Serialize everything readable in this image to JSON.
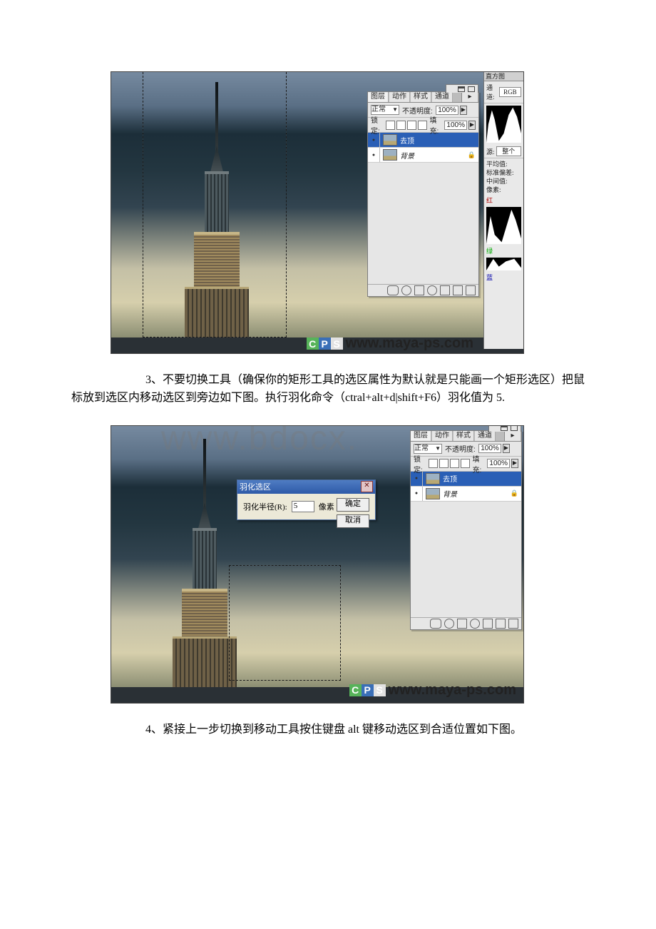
{
  "paragraph3": "3、不要切换工具（确保你的矩形工具的选区属性为默认就是只能画一个矩形选区）把鼠标放到选区内移动选区到旁边如下图。执行羽化命令（ctral+alt+d|shift+F6）羽化值为 5.",
  "paragraph4": "4、紧接上一步切换到移动工具按住键盘 alt 键移动选区到合适位置如下图。",
  "layers_panel": {
    "tabs": [
      "图层",
      "动作",
      "样式",
      "通道"
    ],
    "menu_glyph": "▸",
    "blend_mode": "正常",
    "opacity_label": "不透明度:",
    "opacity_value": "100%",
    "lock_label": "锁定:",
    "fill_label": "填充:",
    "fill_value": "100%",
    "items": [
      {
        "name": "去顶",
        "active": true,
        "has_lock": false
      },
      {
        "name": "背景",
        "active": false,
        "has_lock": true
      }
    ],
    "lock_glyph": "🔒"
  },
  "histogram": {
    "panel_title": "直方图",
    "channel_label": "通道:",
    "channel_value": "RGB",
    "source_label": "源:",
    "source_value": "整个",
    "stats": {
      "mean": "平均值:",
      "stddev": "标准偏差:",
      "median": "中间值:",
      "pixels": "像素:"
    },
    "channels": {
      "r": "红",
      "g": "绿",
      "b": "蓝"
    }
  },
  "feather_dialog": {
    "title": "羽化选区",
    "label": "羽化半径(R):",
    "value": "5",
    "unit": "像素",
    "ok": "确定",
    "cancel": "取消"
  },
  "watermark": {
    "logo_letters": [
      "C",
      "P",
      "S"
    ],
    "text": "www.maya-ps.com"
  },
  "bg_watermark": "www.bdocx."
}
